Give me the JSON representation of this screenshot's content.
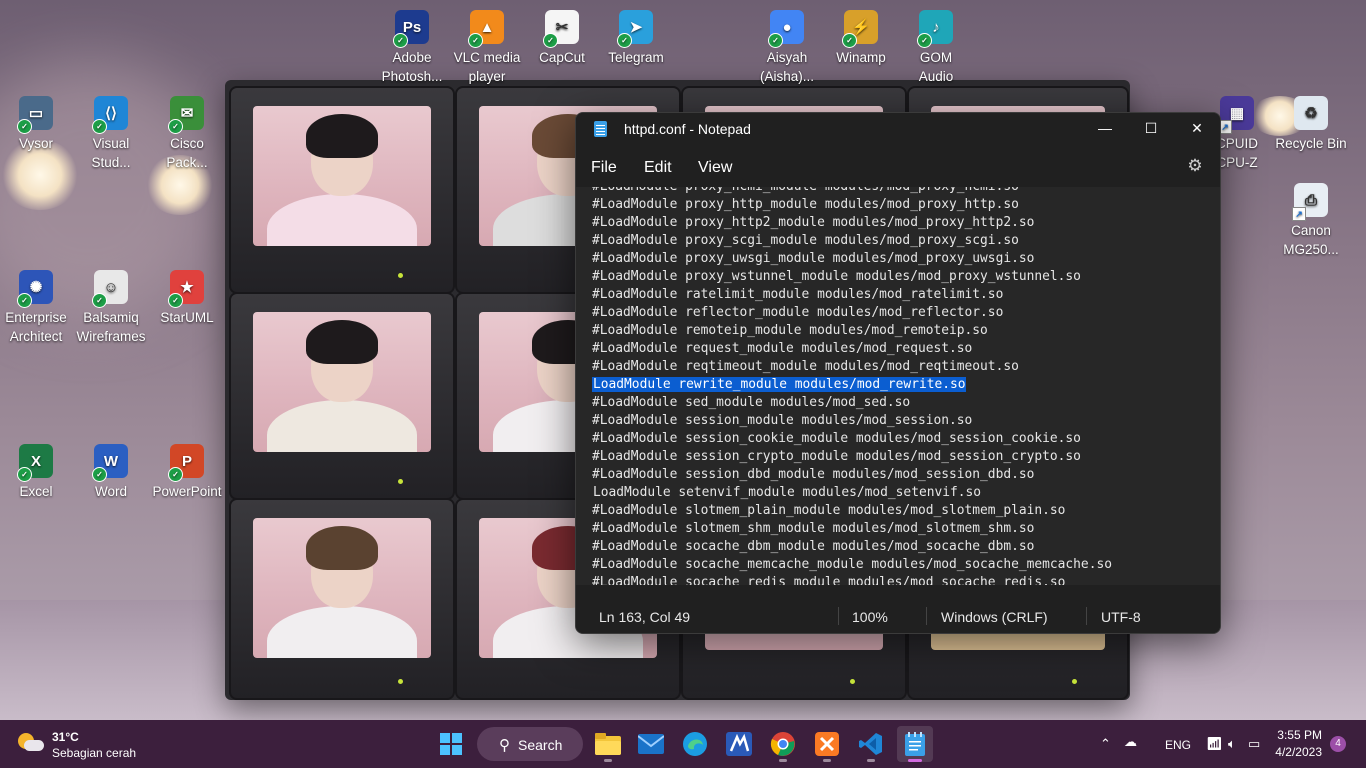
{
  "desktop": {
    "icons": [
      {
        "label": "Adobe\nPhotosh...",
        "icon": "photoshop-icon",
        "color": "#1d3b8f",
        "glyph": "Ps"
      },
      {
        "label": "VLC media\nplayer",
        "icon": "vlc-icon",
        "color": "#f28a1b",
        "glyph": "▲"
      },
      {
        "label": "CapCut",
        "icon": "capcut-icon",
        "color": "#f5f5f5",
        "glyph": "✂"
      },
      {
        "label": "Telegram",
        "icon": "telegram-icon",
        "color": "#2aa0dc",
        "glyph": "➤"
      },
      {
        "label": "Aisyah\n(Aisha)...",
        "icon": "chrome-profile-icon",
        "color": "#4285f4",
        "glyph": "●"
      },
      {
        "label": "Winamp",
        "icon": "winamp-icon",
        "color": "#d8a02a",
        "glyph": "⚡"
      },
      {
        "label": "GOM\nAudio",
        "icon": "gom-audio-icon",
        "color": "#1fa6b8",
        "glyph": "♪"
      },
      {
        "label": "Vysor",
        "icon": "vysor-icon",
        "color": "#4a6a8a",
        "glyph": "▭"
      },
      {
        "label": "Visual\nStud...",
        "icon": "vscode-icon",
        "color": "#1f86d6",
        "glyph": "⟨⟩"
      },
      {
        "label": "Cisco\nPack...",
        "icon": "cisco-packet-tracer-icon",
        "color": "#3a8f3a",
        "glyph": "✉"
      },
      {
        "label": "Enterprise\nArchitect",
        "icon": "enterprise-architect-icon",
        "color": "#2d55b8",
        "glyph": "✺"
      },
      {
        "label": "Balsamiq\nWireframes",
        "icon": "balsamiq-icon",
        "color": "#e8e8e8",
        "glyph": "☺"
      },
      {
        "label": "StarUML",
        "icon": "staruml-icon",
        "color": "#e0413d",
        "glyph": "★"
      },
      {
        "label": "Excel",
        "icon": "excel-icon",
        "color": "#1d7a45",
        "glyph": "X"
      },
      {
        "label": "Word",
        "icon": "word-icon",
        "color": "#2b5fc2",
        "glyph": "W"
      },
      {
        "label": "PowerPoint",
        "icon": "powerpoint-icon",
        "color": "#d24726",
        "glyph": "P"
      },
      {
        "label": "CPUID\nCPU-Z",
        "icon": "cpuz-icon",
        "color": "#4b3a9a",
        "glyph": "▦"
      },
      {
        "label": "Recycle Bin",
        "icon": "recycle-bin-icon",
        "color": "#dfe8f0",
        "glyph": "♻"
      },
      {
        "label": "Canon\nMG250...",
        "icon": "canon-printer-icon",
        "color": "#e8eef4",
        "glyph": "⎙"
      }
    ]
  },
  "notepad": {
    "title": "httpd.conf - Notepad",
    "window_buttons": {
      "minimize": "—",
      "maximize": "☐",
      "close": "✕"
    },
    "menu": [
      "File",
      "Edit",
      "View"
    ],
    "lines": [
      "#LoadModule proxy_hcmi_module modules/mod_proxy_hcmi.so",
      "#LoadModule proxy_http_module modules/mod_proxy_http.so",
      "#LoadModule proxy_http2_module modules/mod_proxy_http2.so",
      "#LoadModule proxy_scgi_module modules/mod_proxy_scgi.so",
      "#LoadModule proxy_uwsgi_module modules/mod_proxy_uwsgi.so",
      "#LoadModule proxy_wstunnel_module modules/mod_proxy_wstunnel.so",
      "#LoadModule ratelimit_module modules/mod_ratelimit.so",
      "#LoadModule reflector_module modules/mod_reflector.so",
      "#LoadModule remoteip_module modules/mod_remoteip.so",
      "#LoadModule request_module modules/mod_request.so",
      "#LoadModule reqtimeout_module modules/mod_reqtimeout.so",
      "LoadModule rewrite_module modules/mod_rewrite.so",
      "#LoadModule sed_module modules/mod_sed.so",
      "#LoadModule session_module modules/mod_session.so",
      "#LoadModule session_cookie_module modules/mod_session_cookie.so",
      "#LoadModule session_crypto_module modules/mod_session_crypto.so",
      "#LoadModule session_dbd_module modules/mod_session_dbd.so",
      "LoadModule setenvif_module modules/mod_setenvif.so",
      "#LoadModule slotmem_plain_module modules/mod_slotmem_plain.so",
      "#LoadModule slotmem_shm_module modules/mod_slotmem_shm.so",
      "#LoadModule socache_dbm_module modules/mod_socache_dbm.so",
      "#LoadModule socache_memcache_module modules/mod_socache_memcache.so",
      "#LoadModule socache_redis_module modules/mod_socache_redis.so"
    ],
    "selected_line": 11,
    "status": {
      "position": "Ln 163, Col 49",
      "zoom": "100%",
      "line_ending": "Windows (CRLF)",
      "encoding": "UTF-8"
    }
  },
  "taskbar": {
    "weather": {
      "temp": "31°C",
      "desc": "Sebagian cerah"
    },
    "search_label": "Search",
    "apps": [
      {
        "icon": "start-windows-icon",
        "active": false
      },
      {
        "icon": "file-explorer-icon",
        "active": false
      },
      {
        "icon": "mail-icon",
        "active": false
      },
      {
        "icon": "edge-icon",
        "active": false
      },
      {
        "icon": "visual-paradigm-icon",
        "active": false
      },
      {
        "icon": "chrome-icon",
        "active": false
      },
      {
        "icon": "xampp-icon",
        "active": false
      },
      {
        "icon": "vscode-taskbar-icon",
        "active": false
      },
      {
        "icon": "notepad-taskbar-icon",
        "active": true
      }
    ],
    "tray": {
      "language": "ENG",
      "time": "3:55 PM",
      "date": "4/2/2023",
      "notification_count": "4"
    }
  }
}
